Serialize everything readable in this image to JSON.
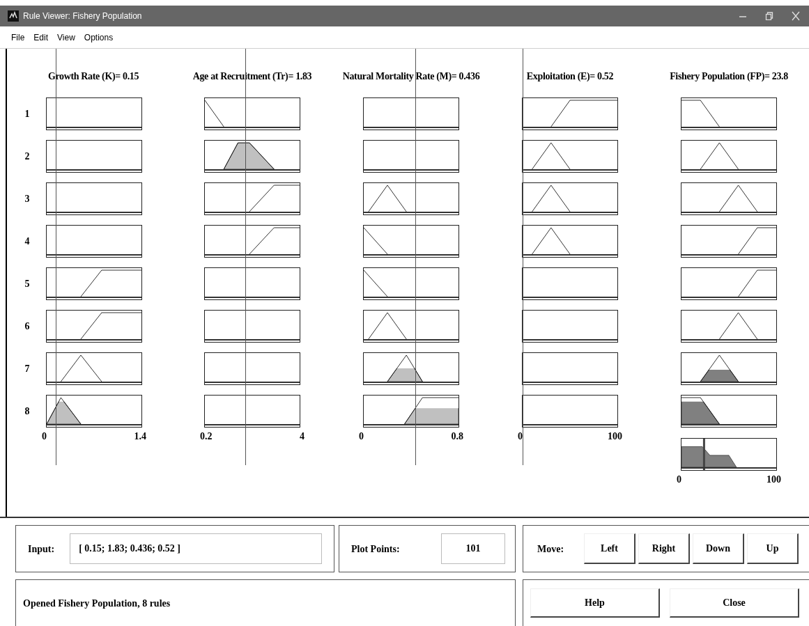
{
  "window": {
    "title": "Rule Viewer: Fishery Population"
  },
  "menu": [
    "File",
    "Edit",
    "View",
    "Options"
  ],
  "rule_numbers": [
    "1",
    "2",
    "3",
    "4",
    "5",
    "6",
    "7",
    "8"
  ],
  "inputs": [
    {
      "title": "Growth Rate (K)= 0.15",
      "range_min": "0",
      "range_max": "1.4"
    },
    {
      "title": "Age at Recruitment (Tr)= 1.83",
      "range_min": "0.2",
      "range_max": "4"
    },
    {
      "title": "Natural Mortality Rate (M)= 0.436",
      "range_min": "0",
      "range_max": "0.8"
    },
    {
      "title": "Exploitation (E)= 0.52",
      "range_min": "0",
      "range_max": "100"
    }
  ],
  "output": {
    "title": "Fishery Population (FP)= 23.8",
    "range_min": "0",
    "range_max": "100"
  },
  "input_panel": {
    "label": "Input:",
    "value": "[ 0.15; 1.83; 0.436; 0.52 ]"
  },
  "plot_points": {
    "label": "Plot Points:",
    "value": "101"
  },
  "move": {
    "label": "Move:",
    "buttons": [
      "Left",
      "Right",
      "Down",
      "Up"
    ]
  },
  "status": "Opened Fishery Population, 8 rules",
  "buttons": [
    "Help",
    "Close"
  ]
}
